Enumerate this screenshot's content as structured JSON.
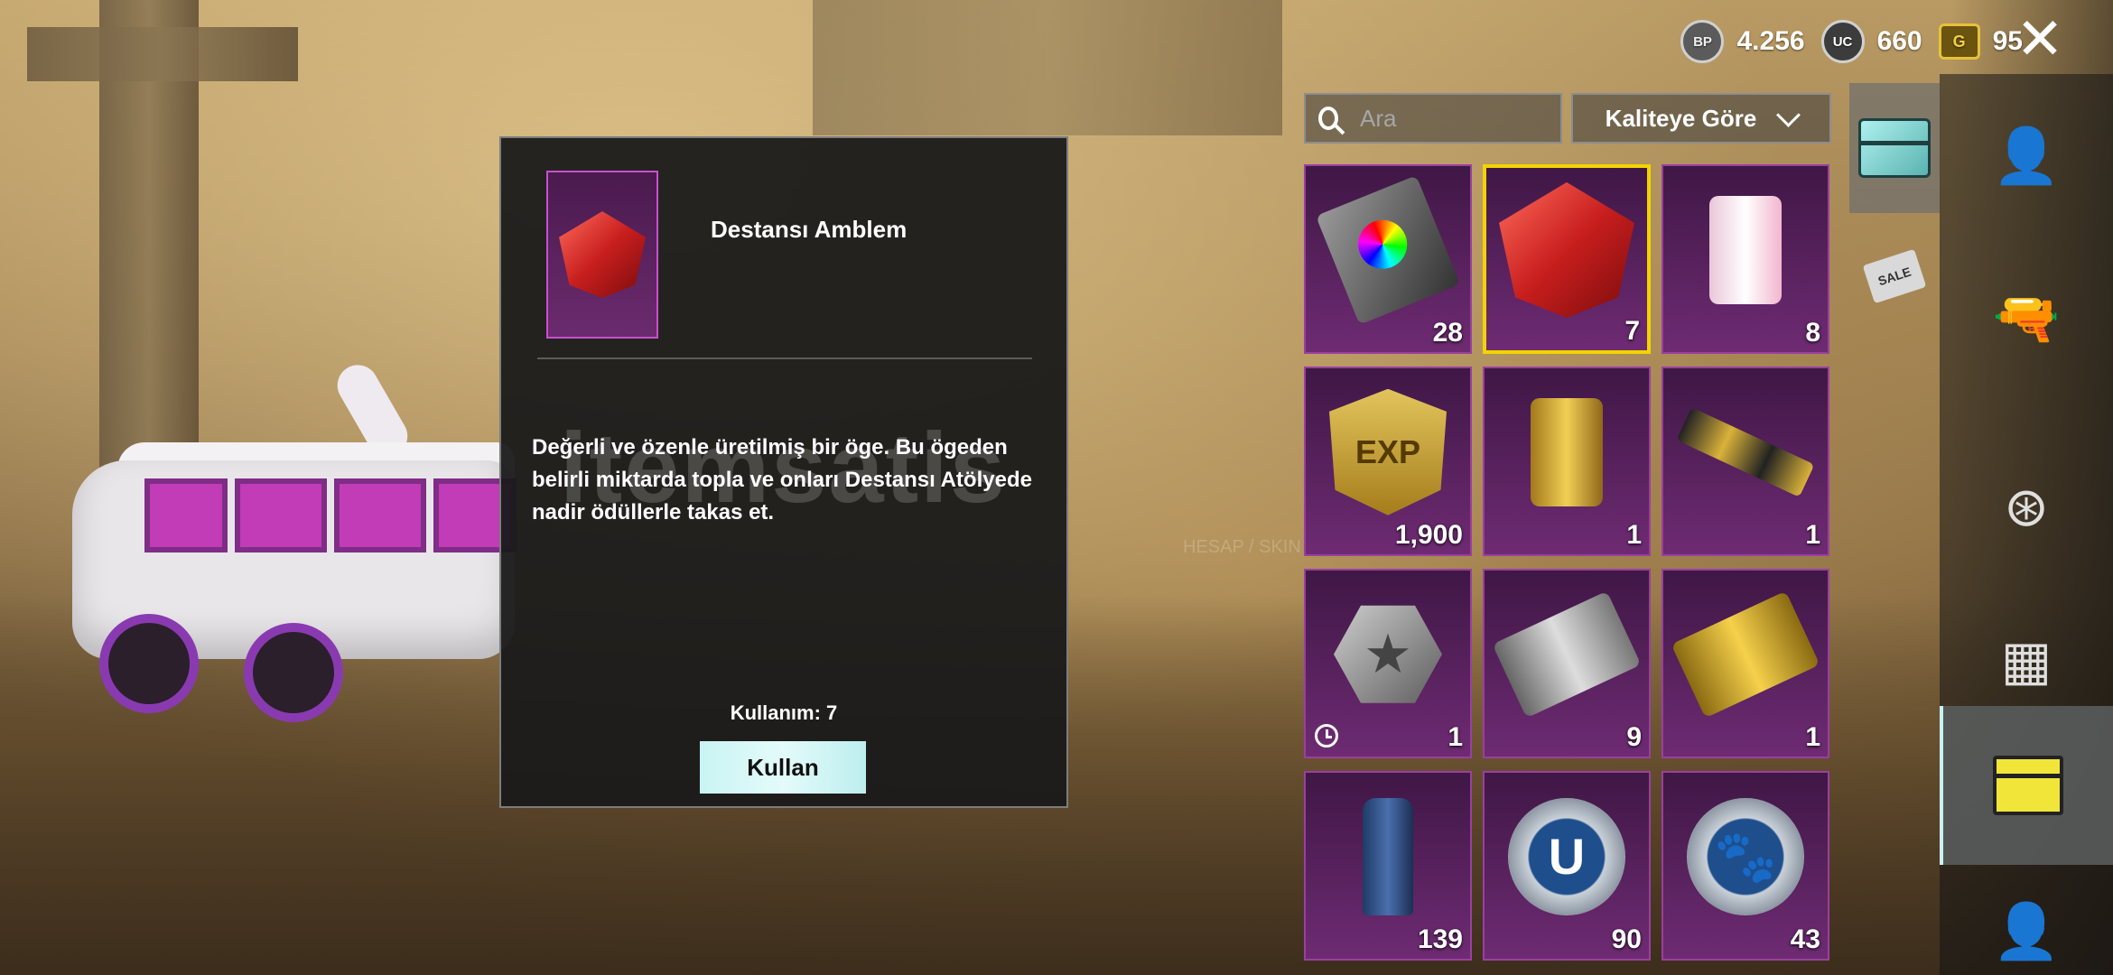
{
  "currency": {
    "bp_icon": "BP",
    "bp": "4.256",
    "uc_icon": "UC",
    "uc": "660",
    "g_icon": "G",
    "g": "95"
  },
  "close_glyph": "✕",
  "detail": {
    "title": "Destansı Amblem",
    "description": "Değerli ve özenle üretilmiş bir öge. Bu ögeden belirli miktarda topla ve onları Destansı Atölyede nadir ödüllerle takas et.",
    "usage": "Kullanım: 7",
    "use_button": "Kullan"
  },
  "watermark": {
    "text": "itemsatis",
    "sub": "HESAP / SKIN / ITEM / .....com"
  },
  "search": {
    "placeholder": "Ara",
    "value": ""
  },
  "sort": {
    "label": "Kaliteye Göre"
  },
  "items": [
    {
      "icon": "color-card",
      "qty": "28"
    },
    {
      "icon": "epic-emblem-gem",
      "qty": "7"
    },
    {
      "icon": "pink-heart-can",
      "qty": "8"
    },
    {
      "icon": "exp-card",
      "exp_label": "EXP",
      "qty": "1,900"
    },
    {
      "icon": "gold-can",
      "qty": "1"
    },
    {
      "icon": "gold-gun-skin",
      "qty": "1"
    },
    {
      "icon": "silver-star-fragment",
      "star": "★",
      "qty": "1"
    },
    {
      "icon": "supply-crate-ticket",
      "qty": "9"
    },
    {
      "icon": "premium-crate-ticket",
      "qty": "1"
    },
    {
      "icon": "spray-can",
      "qty": "139"
    },
    {
      "icon": "silver-coin",
      "coin_label": "U",
      "qty": "90"
    },
    {
      "icon": "paw-coin",
      "coin_label": "🐾",
      "qty": "43"
    }
  ],
  "sidebar": {
    "sale_label": "SALE",
    "tabs": [
      "outfit",
      "weapon",
      "vehicle",
      "rank",
      "inventory",
      "avatar"
    ]
  },
  "colors": {
    "selected_border": "#f2d400",
    "item_bg": "#6e2b73",
    "accent": "#c8f2f0"
  }
}
